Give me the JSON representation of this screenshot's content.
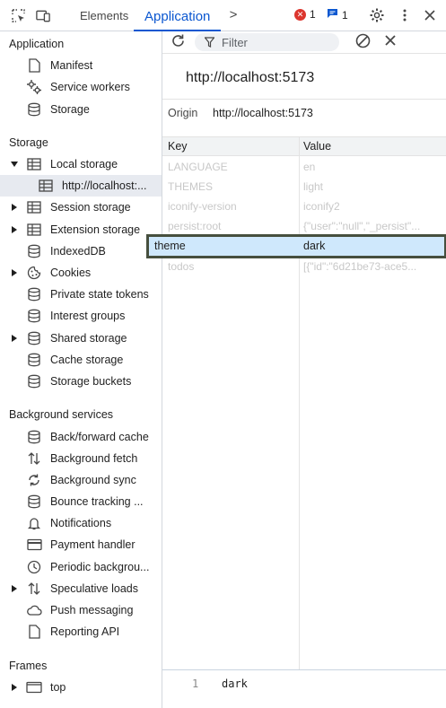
{
  "topbar": {
    "tabs": [
      {
        "label": "Elements",
        "active": false
      },
      {
        "label": "Application",
        "active": true
      }
    ],
    "more_tabs": ">",
    "errors_count": "1",
    "messages_count": "1"
  },
  "sidebar": {
    "application": {
      "title": "Application",
      "items": [
        {
          "label": "Manifest",
          "icon": "file-icon"
        },
        {
          "label": "Service workers",
          "icon": "gears-icon"
        },
        {
          "label": "Storage",
          "icon": "database-icon"
        }
      ]
    },
    "storage": {
      "title": "Storage",
      "items": [
        {
          "label": "Local storage",
          "icon": "table-icon",
          "expanded": true
        },
        {
          "label": "http://localhost:...",
          "icon": "table-icon",
          "selected": true
        },
        {
          "label": "Session storage",
          "icon": "table-icon"
        },
        {
          "label": "Extension storage",
          "icon": "table-icon"
        },
        {
          "label": "IndexedDB",
          "icon": "database-icon"
        },
        {
          "label": "Cookies",
          "icon": "cookie-icon"
        },
        {
          "label": "Private state tokens",
          "icon": "database-icon"
        },
        {
          "label": "Interest groups",
          "icon": "database-icon"
        },
        {
          "label": "Shared storage",
          "icon": "database-icon"
        },
        {
          "label": "Cache storage",
          "icon": "database-icon"
        },
        {
          "label": "Storage buckets",
          "icon": "database-icon"
        }
      ]
    },
    "background": {
      "title": "Background services",
      "items": [
        {
          "label": "Back/forward cache",
          "icon": "database-icon"
        },
        {
          "label": "Background fetch",
          "icon": "updown-arrows-icon"
        },
        {
          "label": "Background sync",
          "icon": "sync-icon"
        },
        {
          "label": "Bounce tracking ...",
          "icon": "database-icon"
        },
        {
          "label": "Notifications",
          "icon": "bell-icon"
        },
        {
          "label": "Payment handler",
          "icon": "card-icon"
        },
        {
          "label": "Periodic backgrou...",
          "icon": "clock-icon"
        },
        {
          "label": "Speculative loads",
          "icon": "updown-arrows-icon"
        },
        {
          "label": "Push messaging",
          "icon": "cloud-icon"
        },
        {
          "label": "Reporting API",
          "icon": "file-icon"
        }
      ]
    },
    "frames": {
      "title": "Frames",
      "items": [
        {
          "label": "top",
          "icon": "frame-icon"
        }
      ]
    }
  },
  "toolbar": {
    "filter_placeholder": "Filter"
  },
  "main": {
    "origin_heading": "http://localhost:5173",
    "origin_label": "Origin",
    "origin_value": "http://localhost:5173",
    "columns": {
      "key": "Key",
      "value": "Value"
    },
    "rows": [
      {
        "key": "LANGUAGE",
        "value": "en"
      },
      {
        "key": "THEMES",
        "value": "light"
      },
      {
        "key": "iconify-version",
        "value": "iconify2"
      },
      {
        "key": "persist:root",
        "value": "{\"user\":\"null\",\"_persist\"..."
      },
      {
        "key": "theme",
        "value": "dark"
      },
      {
        "key": "todos",
        "value": "[{\"id\":\"6d21be73-ace5..."
      }
    ],
    "preview_line_number": "1",
    "preview_value": "dark"
  },
  "colors": {
    "accent": "#0b57d0",
    "selected_row": "#cfe8fc",
    "error": "#dc362e"
  }
}
